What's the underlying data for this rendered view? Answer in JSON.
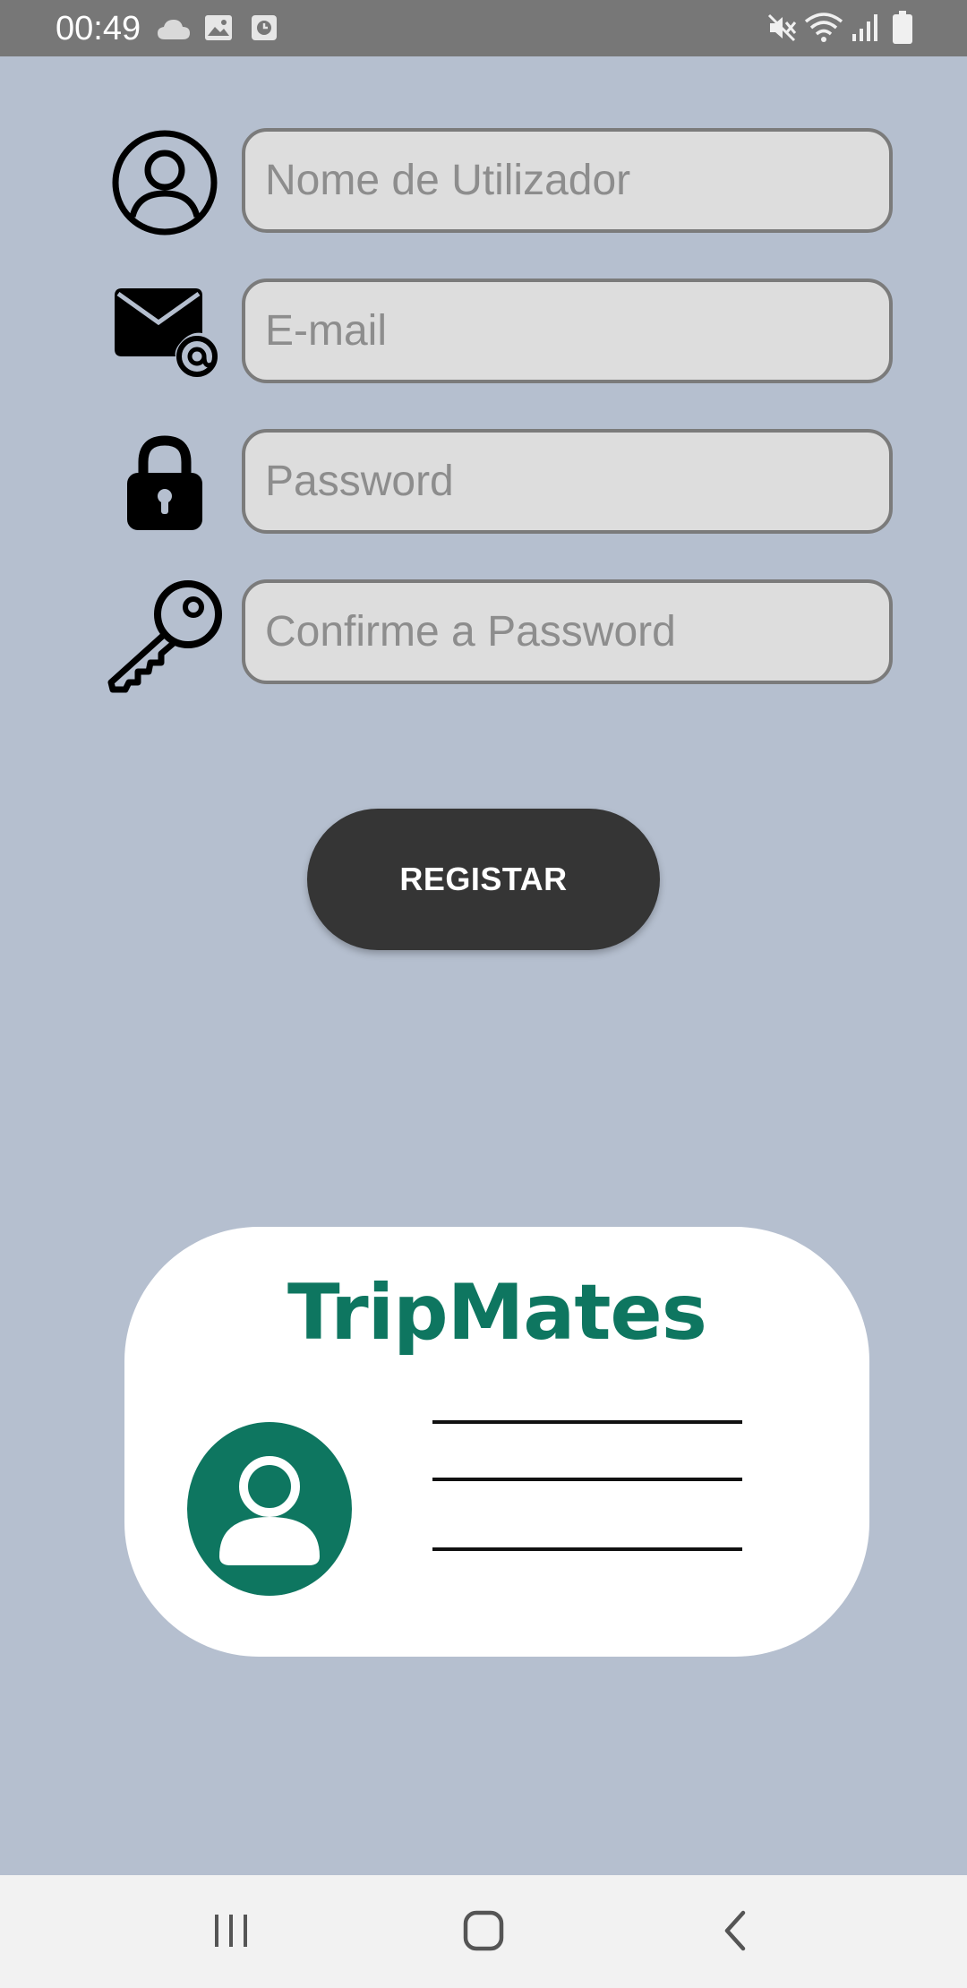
{
  "status_bar": {
    "time": "00:49",
    "left_icons": [
      "cloud-icon",
      "image-icon",
      "clock-app-icon"
    ],
    "right_icons": [
      "mute-icon",
      "wifi-icon",
      "signal-icon",
      "battery-icon"
    ]
  },
  "form": {
    "username": {
      "placeholder": "Nome de Utilizador",
      "value": "",
      "icon": "user-circle-icon"
    },
    "email": {
      "placeholder": "E-mail",
      "value": "",
      "icon": "mail-at-icon"
    },
    "password": {
      "placeholder": "Password",
      "value": "",
      "icon": "lock-icon"
    },
    "confirm_password": {
      "placeholder": "Confirme a Password",
      "value": "",
      "icon": "key-icon"
    },
    "register_label": "REGISTAR"
  },
  "logo": {
    "title": "TripMates",
    "avatar_icon": "user-avatar-icon"
  },
  "nav_bar": {
    "buttons": [
      "recent-apps-icon",
      "home-icon",
      "back-icon"
    ]
  },
  "colors": {
    "background": "#b5bfcf",
    "status_bar": "#777777",
    "field_bg": "#dddddd",
    "field_border": "#7b7b7b",
    "button_bg": "#353535",
    "brand": "#0e7660",
    "nav_bar": "#f2f2f2"
  }
}
